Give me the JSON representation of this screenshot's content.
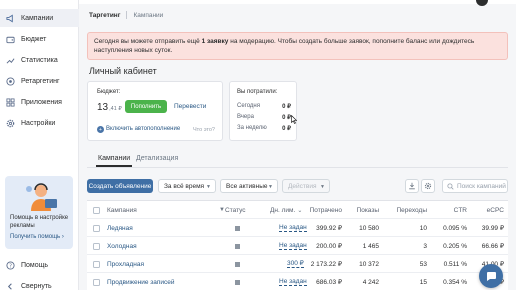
{
  "sidebar": {
    "items": [
      {
        "label": "Кампании",
        "icon": "megaphone-icon"
      },
      {
        "label": "Бюджет",
        "icon": "wallet-icon"
      },
      {
        "label": "Статистика",
        "icon": "chart-icon"
      },
      {
        "label": "Ретаргетинг",
        "icon": "target-icon"
      },
      {
        "label": "Приложения",
        "icon": "apps-icon"
      },
      {
        "label": "Настройки",
        "icon": "gear-icon"
      }
    ],
    "promo": {
      "title": "Помощь в настройке рекламы",
      "link": "Получить помощь ›"
    },
    "bottom": [
      {
        "label": "Помощь",
        "icon": "help-icon"
      },
      {
        "label": "Свернуть",
        "icon": "collapse-icon"
      }
    ]
  },
  "breadcrumbs": {
    "root": "Таргетинг",
    "current": "Кампании"
  },
  "alert": {
    "pre": "Сегодня вы можете отправить ещё ",
    "bold": "1 заявку",
    "post": " на модерацию. Чтобы создать больше заявок, пополните баланс или дождитесь наступления новых суток."
  },
  "cabinet": {
    "title": "Личный кабинет",
    "balance_label": "Бюджет:",
    "balance_value": "13",
    "balance_cents": ",41 ₽",
    "topup_button": "Пополнить",
    "transfer_link": "Перевести",
    "autopay_link": "Включить автопополнение",
    "whatis": "Что это?",
    "spent_title": "Вы потратили:",
    "spent": [
      {
        "label": "Сегодня",
        "value": "0 ₽"
      },
      {
        "label": "Вчера",
        "value": "0 ₽"
      },
      {
        "label": "За неделю",
        "value": "0 ₽"
      }
    ]
  },
  "tabs": [
    {
      "label": "Кампании",
      "active": true
    },
    {
      "label": "Детализация",
      "active": false
    }
  ],
  "toolbar": {
    "create_button": "Создать объявление",
    "period": "За всё время",
    "status_filter": "Все активные",
    "actions": "Действия",
    "search_placeholder": "Поиск кампаний"
  },
  "table": {
    "headers": {
      "name": "Кампания",
      "status": "Статус",
      "limit": "Дн. лим.",
      "spent": "Потрачено",
      "impressions": "Показы",
      "clicks": "Переходы",
      "ctr": "CTR",
      "ecpc": "eCPC"
    },
    "rows": [
      {
        "name": "Ледяная",
        "limit": "Не задан",
        "spent": "399.92 ₽",
        "impressions": "10 580",
        "clicks": "10",
        "ctr": "0.095 %",
        "ecpc": "39.99 ₽"
      },
      {
        "name": "Холодная",
        "limit": "Не задан",
        "spent": "200.00 ₽",
        "impressions": "1 465",
        "clicks": "3",
        "ctr": "0.205 %",
        "ecpc": "66.66 ₽"
      },
      {
        "name": "Прохладная",
        "limit": "300 ₽",
        "spent": "2 173.22 ₽",
        "impressions": "10 372",
        "clicks": "53",
        "ctr": "0.511 %",
        "ecpc": "41.00 ₽"
      },
      {
        "name": "Продвижение записей",
        "limit": "Не задан",
        "spent": "686.03 ₽",
        "impressions": "4 242",
        "clicks": "15",
        "ctr": "0.354 %",
        "ecpc": "45.74 ₽"
      }
    ]
  },
  "colors": {
    "accent": "#3f6fa5",
    "green": "#4bb34b",
    "alert_bg": "#fbe1de",
    "link": "#2a5885"
  }
}
